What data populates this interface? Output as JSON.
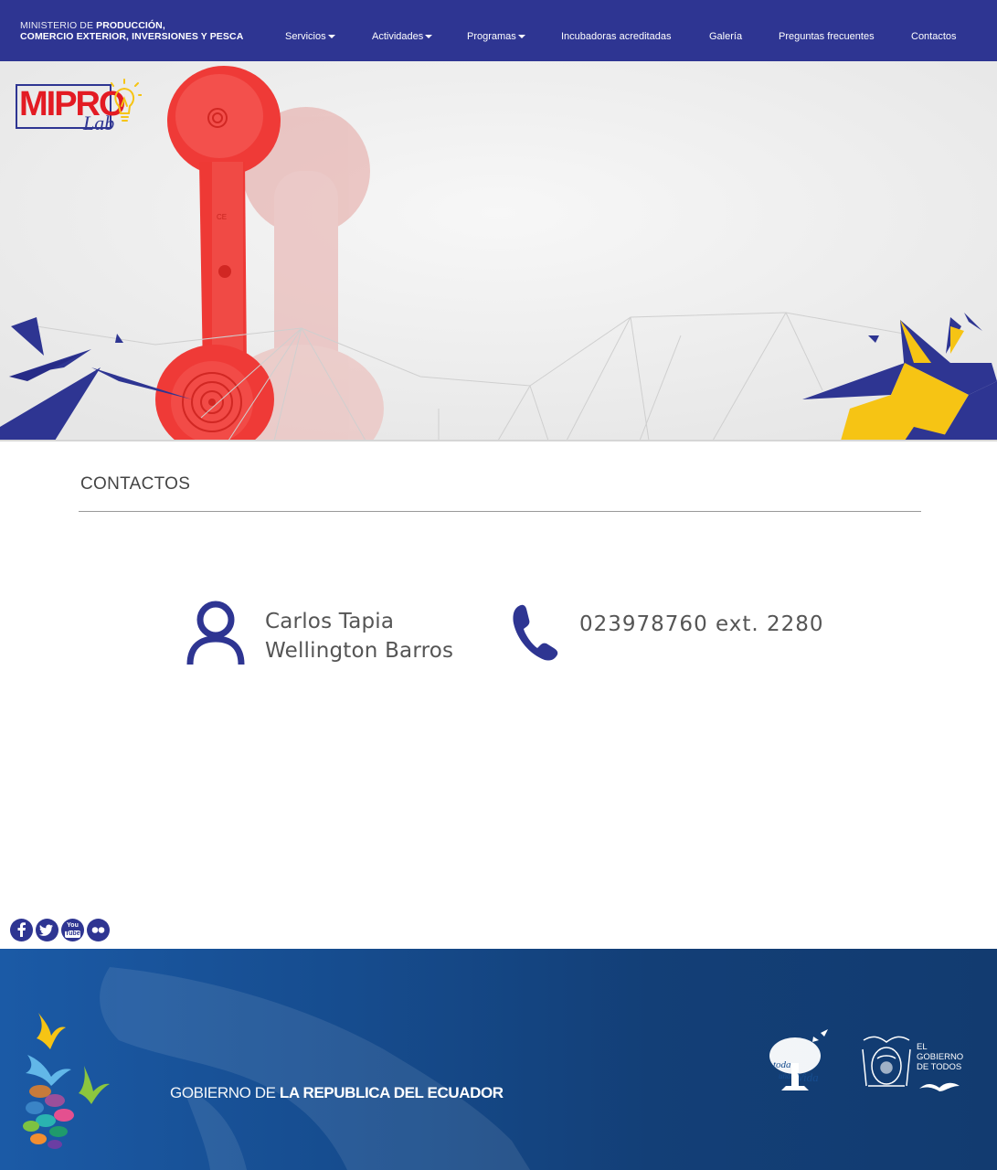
{
  "navbar": {
    "ministry_line1_thin": "MINISTERIO DE",
    "ministry_line1_bold": "PRODUCCIÓN,",
    "ministry_line2": "COMERCIO EXTERIOR, INVERSIONES Y PESCA",
    "items": [
      {
        "label": "Servicios",
        "dropdown": true
      },
      {
        "label": "Actividades",
        "dropdown": true
      },
      {
        "label": "Programas",
        "dropdown": true
      },
      {
        "label": "Incubadoras acreditadas",
        "dropdown": false
      },
      {
        "label": "Galería",
        "dropdown": false
      },
      {
        "label": "Preguntas frecuentes",
        "dropdown": false
      },
      {
        "label": "Contactos",
        "dropdown": false
      }
    ]
  },
  "hero": {
    "logo_text": "MIPRO",
    "logo_sub": "Lab",
    "image_subject": "red-telephone-handset"
  },
  "contact": {
    "title": "CONTACTOS",
    "names": [
      "Carlos Tapia",
      "Wellington Barros"
    ],
    "phone": "023978760 ext. 2280",
    "person_icon": "person-icon",
    "phone_icon": "phone-icon"
  },
  "social": {
    "icons": [
      "facebook-icon",
      "twitter-icon",
      "youtube-icon",
      "flickr-icon"
    ],
    "youtube_label_top": "You",
    "youtube_label_bottom": "Tube"
  },
  "footer": {
    "gov_thin": "GOBIERNO DE",
    "gov_bold": "LA REPUBLICA DEL ECUADOR",
    "toda_una_vida": [
      "toda",
      "una",
      "Vida"
    ],
    "el_gobierno": [
      "EL",
      "GOBIERNO",
      "DE TODOS"
    ]
  },
  "colors": {
    "brand_blue": "#2e3592",
    "brand_red": "#e31b23",
    "accent_yellow": "#f6c414",
    "footer_blue": "#164c8e"
  }
}
